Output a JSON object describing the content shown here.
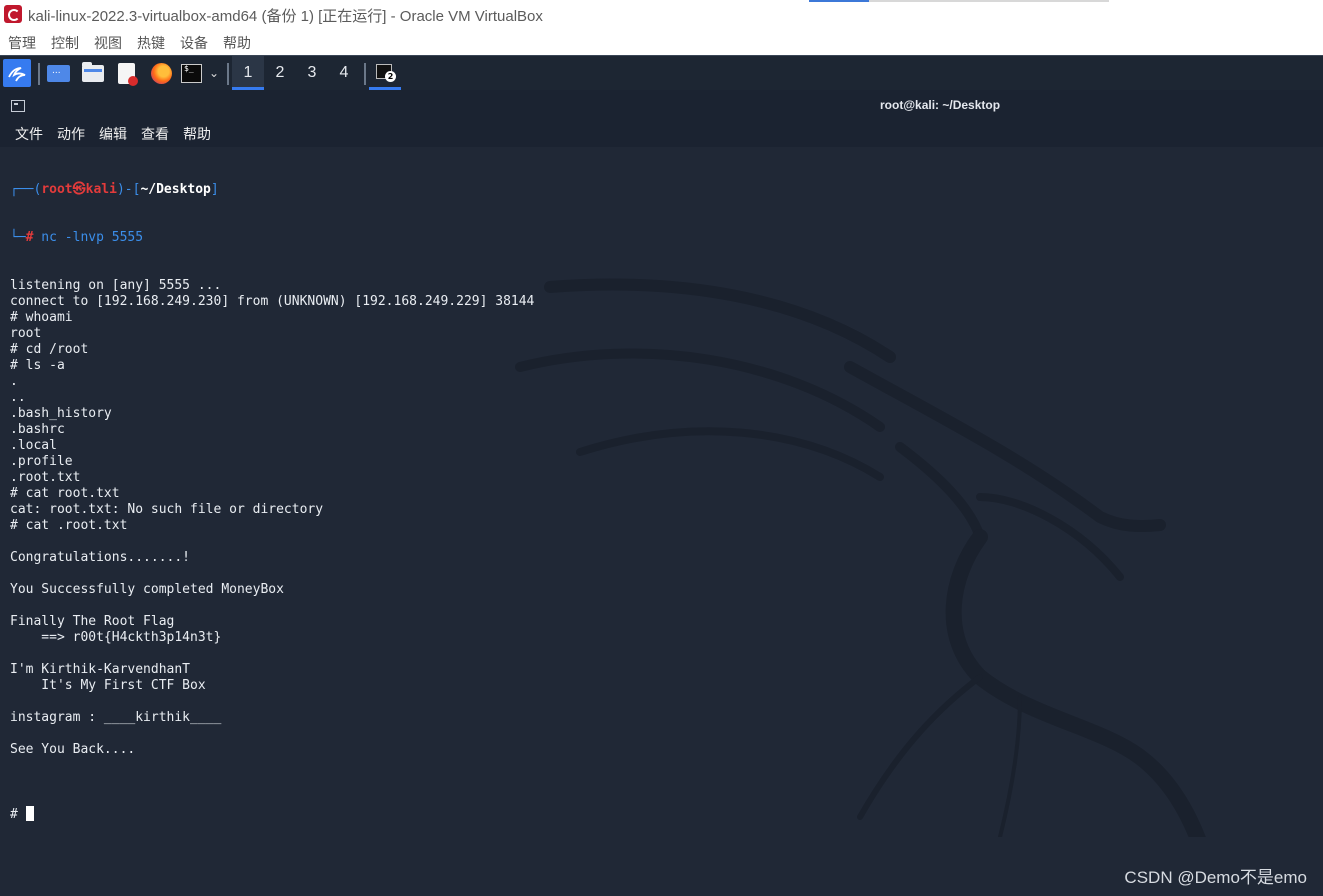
{
  "window": {
    "title": "kali-linux-2022.3-virtualbox-amd64 (备份 1) [正在运行] - Oracle VM VirtualBox"
  },
  "vbox_menu": [
    "管理",
    "控制",
    "视图",
    "热键",
    "设备",
    "帮助"
  ],
  "panel": {
    "icons": [
      "kali-menu-icon",
      "show-desktop-icon",
      "file-manager-icon",
      "text-editor-icon",
      "firefox-icon",
      "terminal-icon",
      "chevron-down-icon"
    ],
    "workspaces": [
      "1",
      "2",
      "3",
      "4"
    ],
    "active_workspace": "1",
    "taskbar_badge": "2"
  },
  "terminal": {
    "title": "root@kali: ~/Desktop",
    "menu": [
      "文件",
      "动作",
      "编辑",
      "查看",
      "帮助"
    ],
    "prompt": {
      "top_left": "┌──(",
      "user": "root",
      "at": "㉿",
      "host": "kali",
      "mid": ")-[",
      "path": "~/Desktop",
      "end": "]",
      "bottom_left": "└─",
      "hash": "#",
      "command": " nc -lnvp 5555"
    },
    "output": [
      "listening on [any] 5555 ...",
      "connect to [192.168.249.230] from (UNKNOWN) [192.168.249.229] 38144",
      "# whoami",
      "root",
      "# cd /root",
      "# ls -a",
      ".",
      "..",
      ".bash_history",
      ".bashrc",
      ".local",
      ".profile",
      ".root.txt",
      "# cat root.txt",
      "cat: root.txt: No such file or directory",
      "# cat .root.txt",
      "",
      "Congratulations.......!",
      "",
      "You Successfully completed MoneyBox",
      "",
      "Finally The Root Flag",
      "    ==> r00t{H4ckth3p14n3t}",
      "",
      "I'm Kirthik-KarvendhanT",
      "    It's My First CTF Box",
      "",
      "instagram : ____kirthik____",
      "",
      "See You Back....",
      ""
    ],
    "final_prompt": "# "
  },
  "watermark": "CSDN @Demo不是emo",
  "colors": {
    "terminal_bg": "#202836",
    "panel_bg": "#1d2633",
    "accent": "#367bf0",
    "prompt_blue": "#3b8eea",
    "prompt_red": "#e33b3b"
  }
}
